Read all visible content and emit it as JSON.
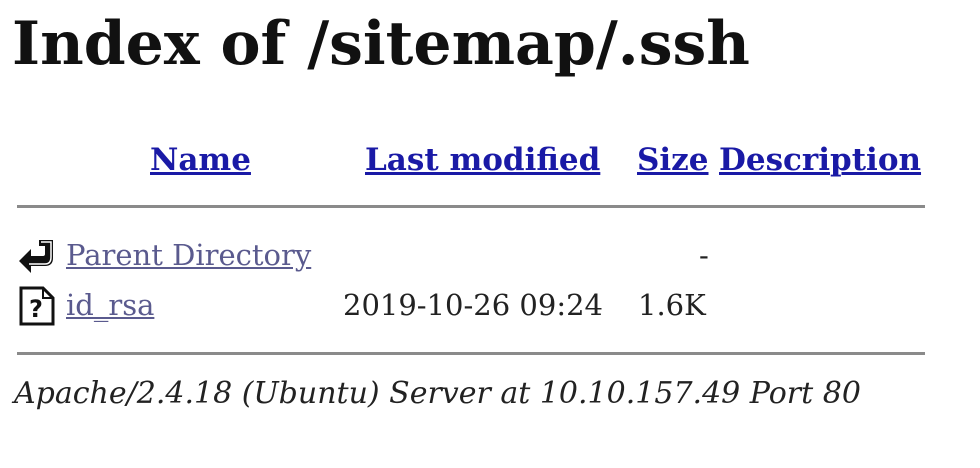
{
  "page_title": "Index of /sitemap/.ssh",
  "table": {
    "headers": {
      "name": "Name",
      "last_modified": "Last modified",
      "size": "Size",
      "description": "Description"
    },
    "rows": [
      {
        "icon": "back-arrow-icon",
        "name": "Parent Directory",
        "last_modified": "",
        "size": "-",
        "description": ""
      },
      {
        "icon": "unknown-file-icon",
        "name": "id_rsa",
        "last_modified": "2019-10-26 09:24",
        "size": "1.6K",
        "description": ""
      }
    ]
  },
  "footer": "Apache/2.4.18 (Ubuntu) Server at 10.10.157.49 Port 80",
  "colors": {
    "header_link": "#1a1aa6",
    "row_link": "#5a5a8e",
    "rule": "#8a8a8a"
  }
}
